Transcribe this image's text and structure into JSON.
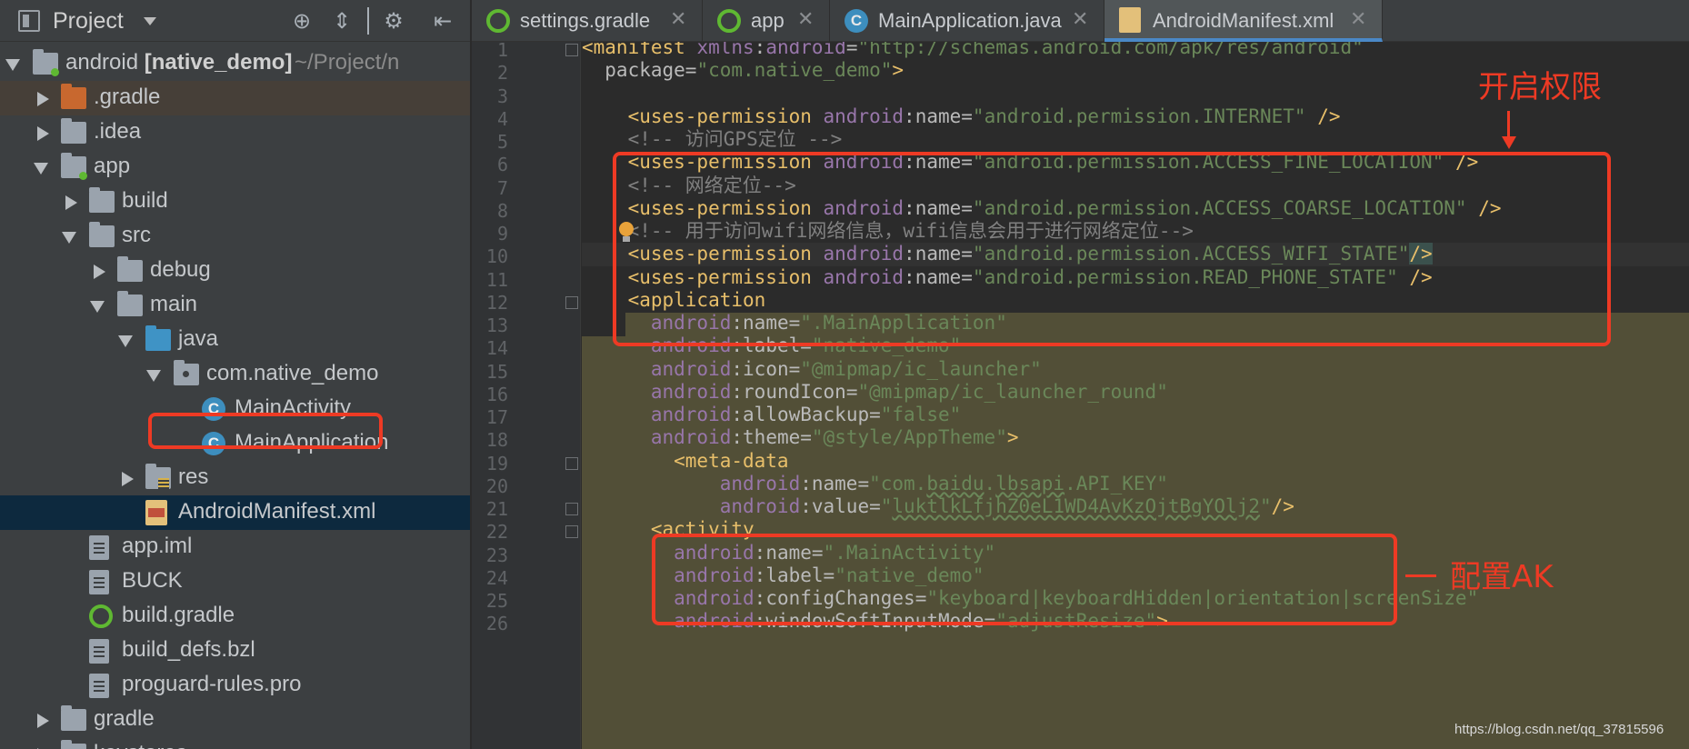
{
  "project_panel": {
    "title": "Project",
    "tree": [
      {
        "label": "android",
        "bold_suffix": "[native_demo]",
        "path": "~/Project/n",
        "depth": 0,
        "state": "expanded",
        "icon": "module-folder-icon"
      },
      {
        "label": ".gradle",
        "depth": 1,
        "state": "collapsed",
        "icon": "excluded-folder-icon"
      },
      {
        "label": ".idea",
        "depth": 1,
        "state": "collapsed",
        "icon": "folder-icon"
      },
      {
        "label": "app",
        "depth": 1,
        "state": "expanded",
        "icon": "module-folder-icon"
      },
      {
        "label": "build",
        "depth": 2,
        "state": "collapsed",
        "icon": "folder-icon"
      },
      {
        "label": "src",
        "depth": 2,
        "state": "expanded",
        "icon": "folder-icon"
      },
      {
        "label": "debug",
        "depth": 3,
        "state": "collapsed",
        "icon": "folder-icon"
      },
      {
        "label": "main",
        "depth": 3,
        "state": "expanded",
        "icon": "folder-icon"
      },
      {
        "label": "java",
        "depth": 4,
        "state": "expanded",
        "icon": "source-folder-icon"
      },
      {
        "label": "com.native_demo",
        "depth": 5,
        "state": "expanded",
        "icon": "package-icon"
      },
      {
        "label": "MainActivity",
        "depth": 6,
        "state": "leaf",
        "icon": "java-class-icon"
      },
      {
        "label": "MainApplication",
        "depth": 6,
        "state": "leaf",
        "icon": "java-class-icon"
      },
      {
        "label": "res",
        "depth": 4,
        "state": "collapsed",
        "icon": "resource-folder-icon"
      },
      {
        "label": "AndroidManifest.xml",
        "depth": 4,
        "state": "leaf",
        "icon": "xml-file-icon"
      },
      {
        "label": "app.iml",
        "depth": 2,
        "state": "leaf",
        "icon": "iml-file-icon"
      },
      {
        "label": "BUCK",
        "depth": 2,
        "state": "leaf",
        "icon": "text-file-icon"
      },
      {
        "label": "build.gradle",
        "depth": 2,
        "state": "leaf",
        "icon": "gradle-file-icon"
      },
      {
        "label": "build_defs.bzl",
        "depth": 2,
        "state": "leaf",
        "icon": "text-file-icon"
      },
      {
        "label": "proguard-rules.pro",
        "depth": 2,
        "state": "leaf",
        "icon": "text-file-icon"
      },
      {
        "label": "gradle",
        "depth": 1,
        "state": "collapsed",
        "icon": "folder-icon"
      },
      {
        "label": "keystores",
        "depth": 1,
        "state": "collapsed",
        "icon": "folder-icon"
      }
    ]
  },
  "tabs": [
    {
      "label": "settings.gradle",
      "icon": "gradle-icon"
    },
    {
      "label": "app",
      "icon": "gradle-icon"
    },
    {
      "label": "MainApplication.java",
      "icon": "java-class-icon"
    },
    {
      "label": "AndroidManifest.xml",
      "icon": "xml-file-icon",
      "active": true
    }
  ],
  "editor": {
    "line_numbers": [
      "1",
      "2",
      "3",
      "4",
      "5",
      "6",
      "7",
      "8",
      "9",
      "10",
      "11",
      "12",
      "13",
      "14",
      "15",
      "16",
      "17",
      "18",
      "19",
      "20",
      "21",
      "22",
      "23",
      "24",
      "25",
      "26"
    ],
    "lines": [
      [
        [
          "tag",
          "<manifest "
        ],
        [
          "attr",
          "xmlns"
        ],
        [
          "punct",
          ":"
        ],
        [
          "attr",
          "android"
        ],
        [
          "punct",
          "="
        ],
        [
          "val",
          "\"http://schemas.android.com/apk/res/android\""
        ]
      ],
      [
        [
          "name",
          "  package"
        ],
        [
          "punct",
          "="
        ],
        [
          "val",
          "\"com.native_demo\""
        ],
        [
          "tag",
          ">"
        ]
      ],
      [],
      [
        [
          "tag",
          "    <uses-permission "
        ],
        [
          "attr",
          "android"
        ],
        [
          "punct",
          ":"
        ],
        [
          "name",
          "name"
        ],
        [
          "punct",
          "="
        ],
        [
          "val",
          "\"android.permission.INTERNET\""
        ],
        [
          "tag",
          " />"
        ]
      ],
      [
        [
          "comment",
          "    <!-- 访问GPS定位 -->"
        ]
      ],
      [
        [
          "tag",
          "    <uses-permission "
        ],
        [
          "attr",
          "android"
        ],
        [
          "punct",
          ":"
        ],
        [
          "name",
          "name"
        ],
        [
          "punct",
          "="
        ],
        [
          "val",
          "\"android.permission.ACCESS_FINE_LOCATION\""
        ],
        [
          "tag",
          " />"
        ]
      ],
      [
        [
          "comment",
          "    <!-- 网络定位-->"
        ]
      ],
      [
        [
          "tag",
          "    <uses-permission "
        ],
        [
          "attr",
          "android"
        ],
        [
          "punct",
          ":"
        ],
        [
          "name",
          "name"
        ],
        [
          "punct",
          "="
        ],
        [
          "val",
          "\"android.permission.ACCESS_COARSE_LOCATION\""
        ],
        [
          "tag",
          " />"
        ]
      ],
      [
        [
          "comment",
          "    <!-- 用于访问wifi网络信息，wifi信息会用于进行网络定位-->"
        ]
      ],
      [
        [
          "tag",
          "    <uses-permission "
        ],
        [
          "attr",
          "android"
        ],
        [
          "punct",
          ":"
        ],
        [
          "name",
          "name"
        ],
        [
          "punct",
          "="
        ],
        [
          "val",
          "\"android.permission.ACCESS_WIFI_STATE\""
        ],
        [
          "tagsel",
          "/>"
        ]
      ],
      [
        [
          "tag",
          "    <uses-permission "
        ],
        [
          "attr",
          "android"
        ],
        [
          "punct",
          ":"
        ],
        [
          "name",
          "name"
        ],
        [
          "punct",
          "="
        ],
        [
          "val",
          "\"android.permission.READ_PHONE_STATE\""
        ],
        [
          "tag",
          " />"
        ]
      ],
      [
        [
          "tag",
          "    <application"
        ]
      ],
      [
        [
          "attr",
          "      android"
        ],
        [
          "punct",
          ":"
        ],
        [
          "name",
          "name"
        ],
        [
          "punct",
          "="
        ],
        [
          "val",
          "\".MainApplication\""
        ]
      ],
      [
        [
          "attr",
          "      android"
        ],
        [
          "punct",
          ":"
        ],
        [
          "name",
          "label"
        ],
        [
          "punct",
          "="
        ],
        [
          "val",
          "\"native_demo\""
        ]
      ],
      [
        [
          "attr",
          "      android"
        ],
        [
          "punct",
          ":"
        ],
        [
          "name",
          "icon"
        ],
        [
          "punct",
          "="
        ],
        [
          "val",
          "\"@mipmap/ic_launcher\""
        ]
      ],
      [
        [
          "attr",
          "      android"
        ],
        [
          "punct",
          ":"
        ],
        [
          "name",
          "roundIcon"
        ],
        [
          "punct",
          "="
        ],
        [
          "val",
          "\"@mipmap/ic_launcher_round\""
        ]
      ],
      [
        [
          "attr",
          "      android"
        ],
        [
          "punct",
          ":"
        ],
        [
          "name",
          "allowBackup"
        ],
        [
          "punct",
          "="
        ],
        [
          "val",
          "\"false\""
        ]
      ],
      [
        [
          "attr",
          "      android"
        ],
        [
          "punct",
          ":"
        ],
        [
          "name",
          "theme"
        ],
        [
          "punct",
          "="
        ],
        [
          "val",
          "\"@style/AppTheme\""
        ],
        [
          "tag",
          ">"
        ]
      ],
      [
        [
          "tag",
          "        <meta-data"
        ]
      ],
      [
        [
          "attr",
          "            android"
        ],
        [
          "punct",
          ":"
        ],
        [
          "name",
          "name"
        ],
        [
          "punct",
          "="
        ],
        [
          "val",
          "\"com."
        ],
        [
          "ak",
          "baidu"
        ],
        [
          "val",
          "."
        ],
        [
          "ak",
          "lbsapi"
        ],
        [
          "val",
          ".API_KEY\""
        ]
      ],
      [
        [
          "attr",
          "            android"
        ],
        [
          "punct",
          ":"
        ],
        [
          "name",
          "value"
        ],
        [
          "punct",
          "="
        ],
        [
          "val",
          "\""
        ],
        [
          "ak",
          "luktlkLfjhZ0eL1WD4AvKzOjtBgYOlj2"
        ],
        [
          "val",
          "\""
        ],
        [
          "tag",
          "/>"
        ]
      ],
      [
        [
          "tag",
          "      <activity"
        ]
      ],
      [
        [
          "attr",
          "        android"
        ],
        [
          "punct",
          ":"
        ],
        [
          "name",
          "name"
        ],
        [
          "punct",
          "="
        ],
        [
          "val",
          "\".MainActivity\""
        ]
      ],
      [
        [
          "attr",
          "        android"
        ],
        [
          "punct",
          ":"
        ],
        [
          "name",
          "label"
        ],
        [
          "punct",
          "="
        ],
        [
          "val",
          "\"native_demo\""
        ]
      ],
      [
        [
          "attr",
          "        android"
        ],
        [
          "punct",
          ":"
        ],
        [
          "name",
          "configChanges"
        ],
        [
          "punct",
          "="
        ],
        [
          "val",
          "\"keyboard|keyboardHidden|orientation|screenSize\""
        ]
      ],
      [
        [
          "attr",
          "        android"
        ],
        [
          "punct",
          ":"
        ],
        [
          "name",
          "windowSoftInputMode"
        ],
        [
          "punct",
          "="
        ],
        [
          "val",
          "\"adjustResize\""
        ],
        [
          "tag",
          ">"
        ]
      ]
    ]
  },
  "annotations": {
    "permissions_label": "开启权限",
    "ak_label": "配置AK",
    "ak_dash": "—"
  },
  "watermark": "https://blog.csdn.net/qq_37815596",
  "colors": {
    "annotation_red": "#ee3a24",
    "tag": "#e8bf6a",
    "attribute": "#9876aa",
    "string": "#6a8759",
    "comment": "#808080"
  }
}
